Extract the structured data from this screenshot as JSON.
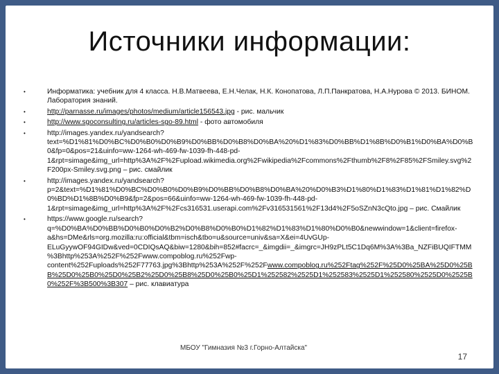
{
  "title": "Источники информации:",
  "items": [
    {
      "text": "Информатика: учебник для 4 класса. Н.В.Матвеева, Е.Н.Челак, Н.К. Конопатова, Л.П.Панкратова, Н.А.Нурова © 2013. БИНОМ. Лаборатория знаний.",
      "link": "",
      "after": ""
    },
    {
      "text": "",
      "link": "http://parnasse.ru/images/photos/medium/article156543.jpg",
      "after": " - рис. мальчик"
    },
    {
      "text": "",
      "link": "http://www.sgoconsulting.ru/articles-sgo-89.html",
      "after": " - фото автомобиля"
    },
    {
      "text": "http://images.yandex.ru/yandsearch?text=%D1%81%D0%BC%D0%B0%D0%B9%D0%BB%D0%B8%D0%BA%20%D1%83%D0%BB%D1%8B%D0%B1%D0%BA%D0%B0&fp=0&pos=21&uinfo=ww-1264-wh-469-fw-1039-fh-448-pd-1&rpt=simage&img_url=http%3A%2F%2Fupload.wikimedia.org%2Fwikipedia%2Fcommons%2Fthumb%2F8%2F85%2FSmiley.svg%2F200px-Smiley.svg.png – рис. смайлик",
      "link": "",
      "after": ""
    },
    {
      "text": "http://images.yandex.ru/yandsearch?p=2&text=%D1%81%D0%BC%D0%B0%D0%B9%D0%BB%D0%B8%D0%BA%20%D0%B3%D1%80%D1%83%D1%81%D1%82%D0%BD%D1%8B%D0%B9&fp=2&pos=66&uinfo=ww-1264-wh-469-fw-1039-fh-448-pd-1&rpt=simage&img_url=http%3A%2F%2Fcs316531.userapi.com%2Fv316531561%2F13d4%2F5oSZnN3cQto.jpg – рис. Смайлик",
      "link": "",
      "after": ""
    },
    {
      "text": "https://www.google.ru/search?q=%D0%BA%D0%BB%D0%B0%D0%B2%D0%B8%D0%B0%D1%82%D1%83%D1%80%D0%B0&newwindow=1&client=firefox-a&hs=DMe&rls=org.mozilla:ru:official&tbm=isch&tbo=u&source=univ&sa=X&ei=4UvGUp-ELuGyywOF94GIDw&ved=0CDIQsAQ&biw=1280&bih=852#facrc=_&imgdii=_&imgrc=JH9zPLt5C1Dq6M%3A%3Ba_NZFiBUQIFTMM%3Bhttp%253A%252F%252Fwww.compoblog.ru%252Fwp-content%252Fuploads%252F77763.jpg%3Bhttp%253A%252F%252F",
      "link": "www.compoblog.ru%252Ftag%252F%25D0%25BA%25D0%25BB%25D0%25B0%25D0%25B2%25D0%25B8%25D0%25B0%25D1%252582%2525D1%252583%2525D1%252580%2525D0%2525B0%252F%3B500%3B307",
      "after": " – рис. клавиатура"
    }
  ],
  "footer": "МБОУ \"Гимназия №3 г.Горно-Алтайска\"",
  "page_number": "17"
}
